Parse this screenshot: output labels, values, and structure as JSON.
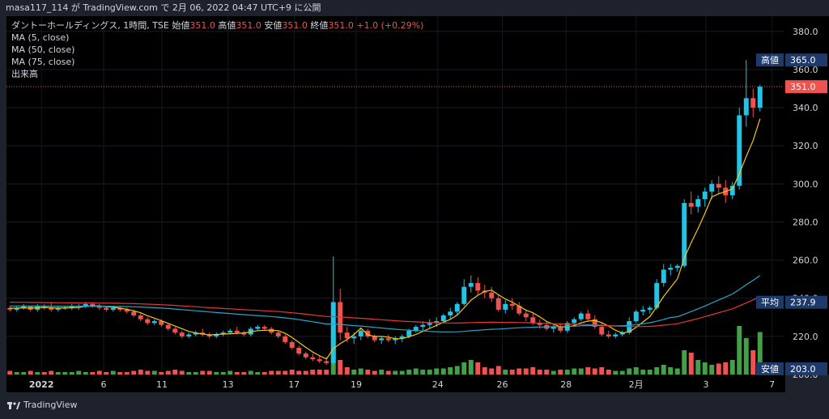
{
  "header": {
    "publisher": "masa117_114 が TradingView.com で 2月 06, 2022 04:47 UTC+9 に公開"
  },
  "legend": {
    "symbol": "ダントーホールディングス, 1時間, TSE",
    "open_label": "始値",
    "open": "351.0",
    "high_label": "高値",
    "high": "351.0",
    "low_label": "安値",
    "low": "351.0",
    "close_label": "終値",
    "close": "351.0",
    "change": "+1.0 (+0.29%)",
    "indicators": [
      "MA (5, close)",
      "MA (50, close)",
      "MA (75, close)",
      "出来高"
    ]
  },
  "colors": {
    "up": "#26a69a",
    "up_bright": "#22c3e6",
    "down": "#ef5350",
    "ma5": "#f5c518",
    "ma50": "#26a6c8",
    "ma75": "#e53935",
    "vol_up": "#43a047",
    "vol_down": "#ef5350"
  },
  "price_axis": {
    "ticks": [
      "380.0",
      "360.0",
      "340.0",
      "320.0",
      "300.0",
      "280.0",
      "260.0",
      "240.0",
      "220.0",
      "200.0"
    ],
    "markers": [
      {
        "label": "高値",
        "value": "365.0",
        "color": "#1e3a6b"
      },
      {
        "label": "",
        "value": "351.0",
        "color": "#ef5350"
      },
      {
        "label": "平均",
        "value": "237.9",
        "color": "#1e3a6b"
      },
      {
        "label": "安値",
        "value": "203.0",
        "color": "#1e3a6b"
      }
    ]
  },
  "time_axis": [
    "2022",
    "6",
    "11",
    "13",
    "17",
    "19",
    "24",
    "26",
    "28",
    "2月",
    "3",
    "7"
  ],
  "footer": {
    "brand": "TradingView"
  },
  "chart_data": {
    "type": "candlestick",
    "ylim": [
      200,
      388
    ],
    "y_unit": "JPY",
    "time_labels": [
      "2022",
      "6",
      "11",
      "13",
      "17",
      "19",
      "24",
      "26",
      "28",
      "2月",
      "3",
      "7"
    ],
    "last_close": 351.0,
    "high_marker": 365.0,
    "avg_marker": 237.9,
    "low_marker": 203.0,
    "candles": [
      [
        235,
        236,
        233,
        234
      ],
      [
        234,
        236,
        233,
        235
      ],
      [
        235,
        237,
        234,
        236
      ],
      [
        236,
        236,
        233,
        234
      ],
      [
        234,
        237,
        233,
        236
      ],
      [
        236,
        237,
        234,
        235
      ],
      [
        235,
        238,
        233,
        234
      ],
      [
        234,
        236,
        233,
        235
      ],
      [
        235,
        236,
        234,
        235
      ],
      [
        235,
        237,
        234,
        236
      ],
      [
        236,
        237,
        234,
        236
      ],
      [
        236,
        238,
        235,
        237
      ],
      [
        237,
        238,
        235,
        236
      ],
      [
        236,
        237,
        234,
        235
      ],
      [
        235,
        236,
        233,
        234
      ],
      [
        234,
        236,
        233,
        235
      ],
      [
        235,
        236,
        233,
        234
      ],
      [
        234,
        235,
        232,
        233
      ],
      [
        233,
        234,
        230,
        231
      ],
      [
        231,
        232,
        228,
        229
      ],
      [
        229,
        230,
        226,
        227
      ],
      [
        227,
        229,
        226,
        228
      ],
      [
        228,
        229,
        225,
        226
      ],
      [
        226,
        227,
        223,
        224
      ],
      [
        224,
        225,
        221,
        222
      ],
      [
        222,
        223,
        219,
        220
      ],
      [
        220,
        222,
        219,
        221
      ],
      [
        221,
        223,
        220,
        222
      ],
      [
        222,
        224,
        220,
        221
      ],
      [
        221,
        222,
        219,
        220
      ],
      [
        220,
        222,
        219,
        221
      ],
      [
        221,
        223,
        220,
        222
      ],
      [
        222,
        224,
        221,
        223
      ],
      [
        223,
        225,
        221,
        222
      ],
      [
        222,
        223,
        220,
        221
      ],
      [
        221,
        225,
        220,
        224
      ],
      [
        224,
        226,
        223,
        225
      ],
      [
        225,
        226,
        223,
        224
      ],
      [
        224,
        225,
        221,
        222
      ],
      [
        222,
        223,
        219,
        220
      ],
      [
        220,
        221,
        216,
        217
      ],
      [
        217,
        218,
        213,
        214
      ],
      [
        214,
        215,
        210,
        211
      ],
      [
        211,
        212,
        208,
        209
      ],
      [
        209,
        211,
        207,
        208
      ],
      [
        208,
        210,
        206,
        207
      ],
      [
        207,
        209,
        205,
        206
      ],
      [
        206,
        262,
        205,
        238
      ],
      [
        238,
        245,
        218,
        222
      ],
      [
        222,
        225,
        217,
        219
      ],
      [
        219,
        222,
        216,
        220
      ],
      [
        220,
        224,
        218,
        223
      ],
      [
        223,
        224,
        219,
        220
      ],
      [
        220,
        221,
        217,
        218
      ],
      [
        218,
        220,
        216,
        219
      ],
      [
        219,
        221,
        217,
        218
      ],
      [
        218,
        220,
        216,
        219
      ],
      [
        219,
        221,
        217,
        220
      ],
      [
        220,
        224,
        219,
        223
      ],
      [
        223,
        226,
        222,
        225
      ],
      [
        225,
        228,
        223,
        226
      ],
      [
        226,
        229,
        224,
        227
      ],
      [
        227,
        230,
        225,
        228
      ],
      [
        228,
        232,
        227,
        231
      ],
      [
        231,
        235,
        229,
        233
      ],
      [
        233,
        238,
        231,
        237
      ],
      [
        237,
        250,
        236,
        246
      ],
      [
        246,
        252,
        243,
        248
      ],
      [
        248,
        251,
        242,
        244
      ],
      [
        244,
        247,
        240,
        243
      ],
      [
        243,
        246,
        238,
        240
      ],
      [
        240,
        242,
        233,
        234
      ],
      [
        234,
        239,
        232,
        237
      ],
      [
        237,
        240,
        234,
        236
      ],
      [
        236,
        238,
        231,
        232
      ],
      [
        232,
        234,
        228,
        230
      ],
      [
        230,
        232,
        226,
        227
      ],
      [
        227,
        229,
        224,
        226
      ],
      [
        226,
        228,
        223,
        224
      ],
      [
        224,
        226,
        222,
        225
      ],
      [
        225,
        227,
        222,
        223
      ],
      [
        223,
        228,
        222,
        227
      ],
      [
        227,
        230,
        225,
        229
      ],
      [
        229,
        233,
        228,
        232
      ],
      [
        232,
        234,
        228,
        229
      ],
      [
        229,
        231,
        224,
        225
      ],
      [
        225,
        227,
        220,
        221
      ],
      [
        221,
        223,
        219,
        220
      ],
      [
        220,
        222,
        219,
        221
      ],
      [
        221,
        223,
        220,
        222
      ],
      [
        222,
        230,
        221,
        228
      ],
      [
        228,
        234,
        227,
        233
      ],
      [
        233,
        236,
        231,
        234
      ],
      [
        234,
        236,
        232,
        235
      ],
      [
        235,
        250,
        234,
        248
      ],
      [
        248,
        258,
        246,
        255
      ],
      [
        255,
        258,
        252,
        256
      ],
      [
        256,
        258,
        254,
        257
      ],
      [
        257,
        292,
        256,
        290
      ],
      [
        290,
        296,
        284,
        288
      ],
      [
        288,
        294,
        285,
        292
      ],
      [
        292,
        298,
        288,
        296
      ],
      [
        296,
        302,
        292,
        300
      ],
      [
        300,
        304,
        295,
        298
      ],
      [
        298,
        302,
        290,
        294
      ],
      [
        294,
        301,
        292,
        299
      ],
      [
        299,
        340,
        297,
        336
      ],
      [
        336,
        365,
        330,
        345
      ],
      [
        345,
        350,
        335,
        340
      ],
      [
        340,
        352,
        338,
        351
      ]
    ],
    "volume": [
      3,
      2,
      2,
      3,
      2,
      2,
      3,
      2,
      2,
      2,
      3,
      2,
      2,
      3,
      2,
      3,
      2,
      2,
      3,
      4,
      3,
      3,
      2,
      3,
      4,
      3,
      2,
      2,
      3,
      3,
      2,
      2,
      3,
      2,
      2,
      3,
      2,
      2,
      3,
      3,
      3,
      4,
      3,
      3,
      4,
      4,
      4,
      40,
      12,
      6,
      4,
      5,
      4,
      3,
      4,
      3,
      3,
      3,
      4,
      5,
      4,
      4,
      5,
      5,
      6,
      7,
      10,
      12,
      10,
      6,
      5,
      7,
      4,
      4,
      5,
      5,
      6,
      4,
      4,
      3,
      4,
      4,
      5,
      5,
      6,
      5,
      6,
      4,
      3,
      3,
      5,
      6,
      4,
      4,
      6,
      8,
      6,
      5,
      20,
      18,
      12,
      10,
      8,
      9,
      10,
      12,
      40,
      30,
      20,
      35
    ]
  }
}
